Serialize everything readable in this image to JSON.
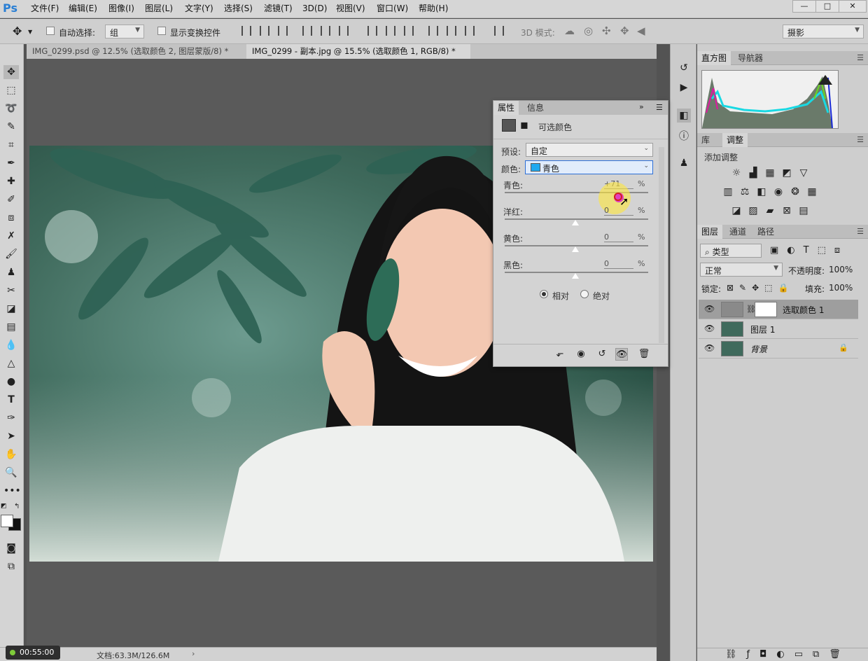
{
  "app": {
    "logo": "Ps"
  },
  "menu": [
    "文件(F)",
    "编辑(E)",
    "图像(I)",
    "图层(L)",
    "文字(Y)",
    "选择(S)",
    "滤镜(T)",
    "3D(D)",
    "视图(V)",
    "窗口(W)",
    "帮助(H)"
  ],
  "window_controls": {
    "minimize": "—",
    "maximize": "□",
    "close": "✕"
  },
  "options": {
    "auto_select_label": "自动选择:",
    "auto_select_value": "组",
    "show_transform_label": "显示变换控件",
    "mode_3d_label": "3D 模式:",
    "workspace": "摄影"
  },
  "tabs": [
    {
      "label": "IMG_0299.psd @ 12.5% (选取颜色 2, 图层蒙版/8) *"
    },
    {
      "label": "IMG_0299 - 副本.jpg @ 15.5% (选取颜色 1, RGB/8) *"
    }
  ],
  "status": {
    "timer": "00:55:00",
    "doc": "文档:63.3M/126.6M"
  },
  "panels": {
    "top_tabs": [
      "直方图",
      "导航器"
    ],
    "adj_tabs": [
      "库",
      "调整"
    ],
    "adj_title": "添加调整",
    "layers_tabs": [
      "图层",
      "通道",
      "路径"
    ],
    "filter_kind": "类型",
    "blend_mode": "正常",
    "opacity_label": "不透明度:",
    "opacity_value": "100%",
    "lock_label": "锁定:",
    "fill_label": "填充:",
    "fill_value": "100%",
    "layers": [
      {
        "name": "选取颜色 1",
        "selected": true
      },
      {
        "name": "图层 1"
      },
      {
        "name": "背景"
      }
    ]
  },
  "properties": {
    "tabs": [
      "属性",
      "信息"
    ],
    "title": "可选颜色",
    "preset_label": "预设:",
    "preset_value": "自定",
    "colors_label": "颜色:",
    "colors_value": "青色",
    "colors_swatch": "#1fa9f0",
    "sliders": [
      {
        "label": "青色:",
        "value": "+71",
        "level": 71
      },
      {
        "label": "洋红:",
        "value": "0",
        "level": 0
      },
      {
        "label": "黄色:",
        "value": "0",
        "level": 0
      },
      {
        "label": "黑色:",
        "value": "0",
        "level": 0
      }
    ],
    "pct": "%",
    "method_relative": "相对",
    "method_absolute": "绝对"
  }
}
